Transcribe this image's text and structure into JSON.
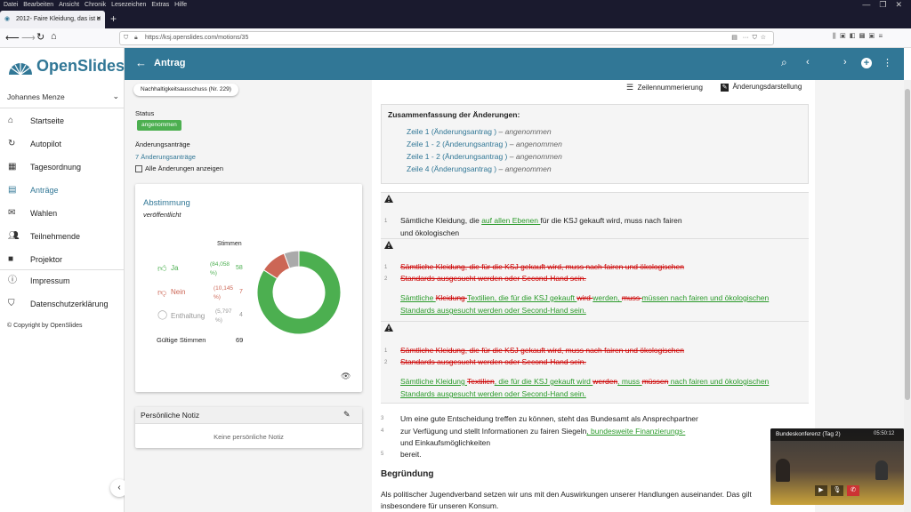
{
  "menubar": [
    "Datei",
    "Bearbeiten",
    "Ansicht",
    "Chronik",
    "Lesezeichen",
    "Extras",
    "Hilfe"
  ],
  "browser": {
    "tab_title": "2012- Faire Kleidung, das ist e",
    "url": "https://ksj.openslides.com/motions/35"
  },
  "brand": "OpenSlides",
  "user": "Johannes Menze",
  "nav": [
    {
      "label": "Startseite",
      "icon": "home-icon"
    },
    {
      "label": "Autopilot",
      "icon": "sync-icon"
    },
    {
      "label": "Tagesordnung",
      "icon": "calendar-icon"
    },
    {
      "label": "Anträge",
      "icon": "document-icon"
    },
    {
      "label": "Wahlen",
      "icon": "ballot-icon"
    },
    {
      "label": "Teilnehmende",
      "icon": "people-icon"
    },
    {
      "label": "Projektor",
      "icon": "video-icon"
    },
    {
      "label": "Impressum",
      "icon": "info-icon"
    },
    {
      "label": "Datenschutzerklärung",
      "icon": "shield-icon"
    }
  ],
  "copyright": "© Copyright by OpenSlides",
  "header": {
    "title": "Antrag"
  },
  "left": {
    "committee": "Nachhaltigkeitsausschuss (Nr. 229)",
    "status_label": "Status",
    "status_value": "angenommen",
    "amend_label": "Änderungsanträge",
    "amend_link": "7 Änderungsanträge",
    "show_all": "Alle Änderungen anzeigen",
    "poll_title": "Abstimmung",
    "poll_state": "veröffentlicht",
    "votes_header": "Stimmen",
    "ja": "Ja",
    "ja_pct": "(84,058 %)",
    "ja_n": "58",
    "nein": "Nein",
    "nein_pct": "(10,145 %)",
    "nein_n": "7",
    "enth": "Enthaltung",
    "enth_pct": "(5,797 %)",
    "enth_n": "4",
    "valid_label": "Gültige Stimmen",
    "valid_n": "69",
    "note_title": "Persönliche Notiz",
    "note_empty": "Keine persönliche Notiz"
  },
  "chart_data": {
    "type": "pie",
    "categories": [
      "Ja",
      "Nein",
      "Enthaltung"
    ],
    "values": [
      58,
      7,
      4
    ],
    "colors": [
      "#4caf50",
      "#cc6655",
      "#aaaaaa"
    ]
  },
  "toolbar": {
    "line_num": "Zeilennummerierung",
    "change_view": "Änderungsdarstellung"
  },
  "summary": {
    "title": "Zusammenfassung der Änderungen:",
    "items": [
      {
        "link": "Zeile 1 (Änderungsantrag )",
        "state": "– angenommen"
      },
      {
        "link": "Zeile 1 - 2 (Änderungsantrag )",
        "state": "– angenommen"
      },
      {
        "link": "Zeile 1 - 2 (Änderungsantrag )",
        "state": "– angenommen"
      },
      {
        "link": "Zeile 4 (Änderungsantrag )",
        "state": "– angenommen"
      }
    ]
  },
  "c1": {
    "a": "Sämtliche Kleidung, die ",
    "ins": "auf allen Ebenen ",
    "b": "für die KSJ gekauft wird, muss nach fairen",
    "l2": "und ökologischen"
  },
  "c2": {
    "del1": "Sämtliche Kleidung, die für die KSJ gekauft wird, muss nach fairen und ökologischen",
    "del2": "Standards ausgesucht werden oder Second-Hand sein.",
    "i1a": "Sämtliche ",
    "d1": "Kleidung ",
    "i1b": "Textilien, die für die KSJ gekauft ",
    "d2": "wird ",
    "i1c": "werden, ",
    "d3": "muss ",
    "i1d": "müssen nach fairen und ökologischen",
    "i2": "Standards ausgesucht werden oder Second-Hand sein."
  },
  "c3": {
    "del1": "Sämtliche Kleidung, die für die KSJ gekauft wird, muss nach fairen und ökologischen",
    "del2": "Standards ausgesucht werden oder Second-Hand sein.",
    "i1a": "Sämtliche Kleidung ",
    "d1": "Textilien",
    "i1b": ", die für die KSJ gekauft wird ",
    "d2": "werden",
    "i1c": ", muss ",
    "d3": "müssen",
    "i1d": " nach fairen und ökologischen",
    "i2": "Standards ausgesucht werden oder Second-Hand sein."
  },
  "body": {
    "l3": "Um eine gute Entscheidung treffen zu können, steht das Bundesamt als Ansprechpartner",
    "l4a": "zur Verfügung und stellt Informationen zu fairen Siegeln",
    "l4ins": ", bundesweite Finanzierungs-",
    "l4b": "und Einkaufsmöglichkeiten",
    "l5": "bereit.",
    "reason_title": "Begründung",
    "reason1": "Als politischer Jugendverband setzen wir uns mit den Auswirkungen unserer Handlungen auseinander. Das gilt",
    "reason2": "insbesondere für unseren Konsum."
  },
  "video": {
    "title": "Bundeskonferenz (Tag 2)",
    "time": "05:50:12"
  }
}
